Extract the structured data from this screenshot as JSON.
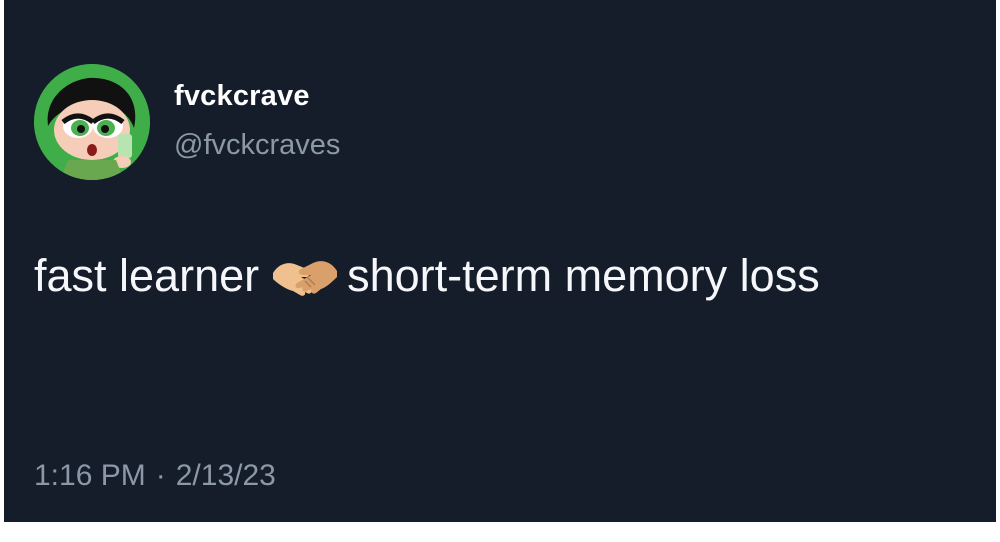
{
  "tweet": {
    "display_name": "fvckcrave",
    "handle": "@fvckcraves",
    "text_before_emoji": "fast learner",
    "emoji": "handshake-icon",
    "text_after_emoji": "short-term memory loss",
    "time": "1:16 PM",
    "separator": "·",
    "date": "2/13/23"
  },
  "colors": {
    "background": "#151c2a",
    "avatar_green": "#3fae49",
    "secondary_text": "#8b98a5",
    "primary_text": "#f5f7fa"
  },
  "avatar": {
    "icon": "powerpuff-buttercup-avatar-icon"
  }
}
